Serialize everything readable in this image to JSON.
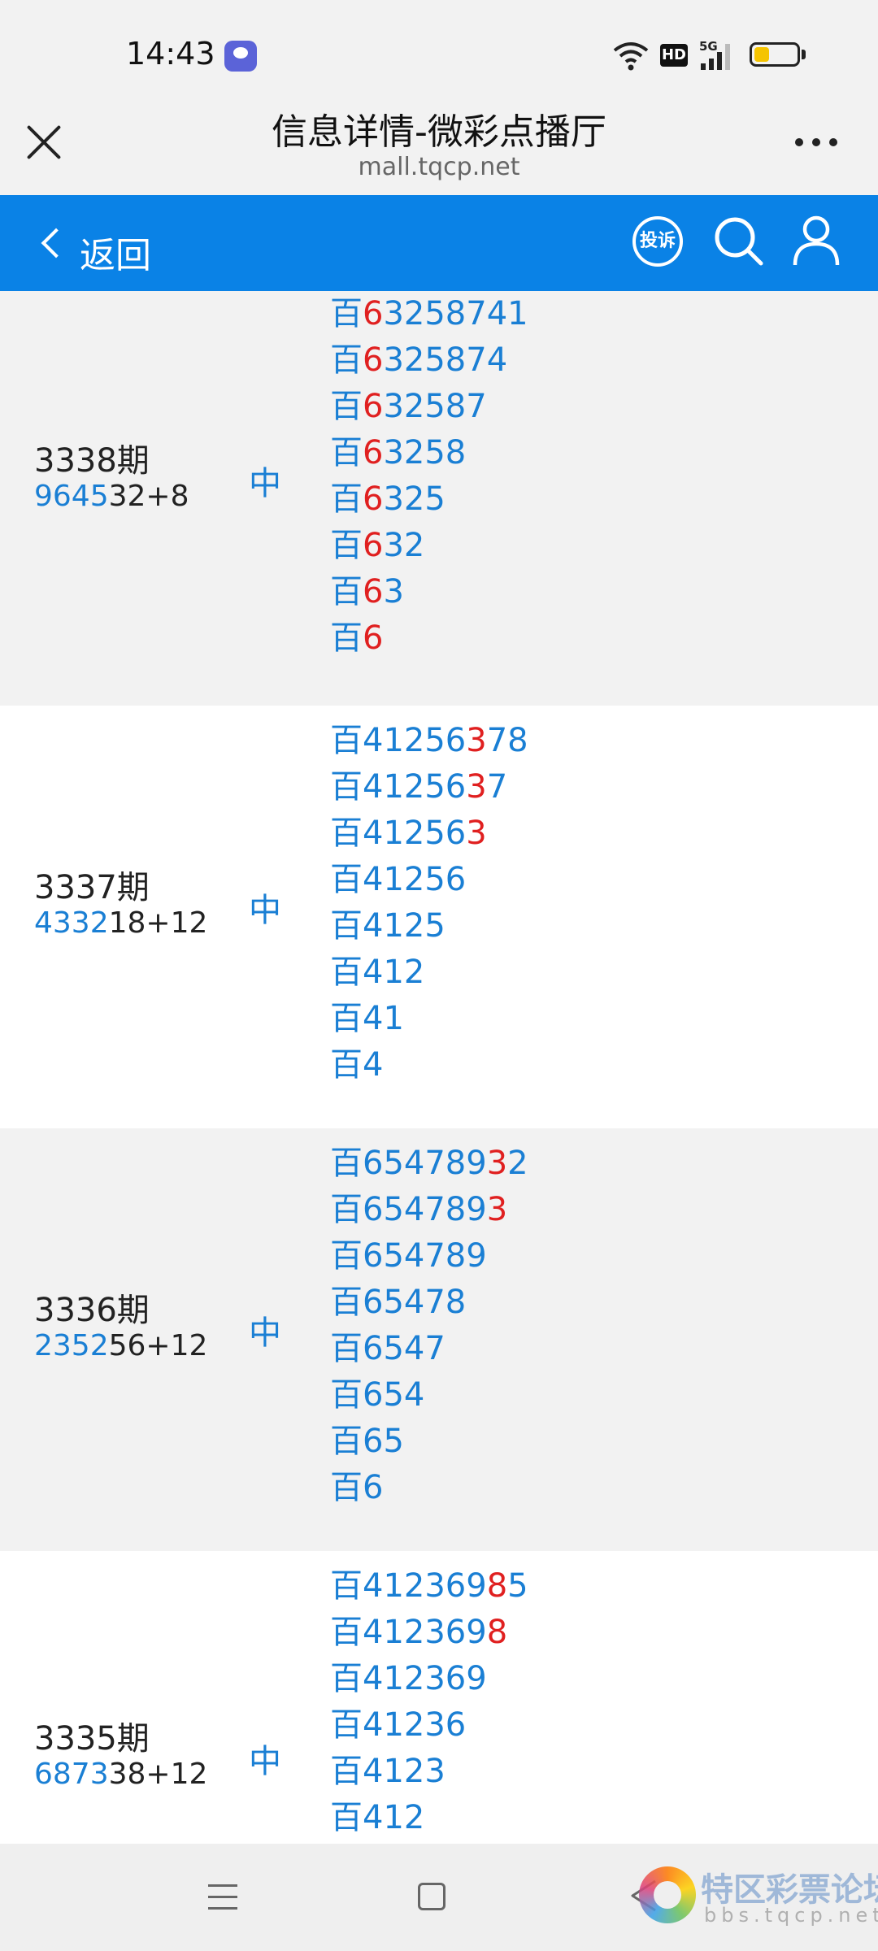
{
  "status_bar": {
    "time": "14:43",
    "hd_label": "HD",
    "network_label": "5G",
    "battery_level": 0.35
  },
  "browser": {
    "title": "信息详情-微彩点播厅",
    "url": "mall.tqcp.net"
  },
  "toolbar": {
    "back_label": "返回",
    "complain_label": "投诉"
  },
  "rows": [
    {
      "period": "3338期",
      "draw_hl": "9645",
      "draw_rest": "32+8",
      "status": "中",
      "picks": [
        {
          "prefix": "百",
          "pre": "",
          "red": "6",
          "post": "3258741"
        },
        {
          "prefix": "百",
          "pre": "",
          "red": "6",
          "post": "325874"
        },
        {
          "prefix": "百",
          "pre": "",
          "red": "6",
          "post": "32587"
        },
        {
          "prefix": "百",
          "pre": "",
          "red": "6",
          "post": "3258"
        },
        {
          "prefix": "百",
          "pre": "",
          "red": "6",
          "post": "325"
        },
        {
          "prefix": "百",
          "pre": "",
          "red": "6",
          "post": "32"
        },
        {
          "prefix": "百",
          "pre": "",
          "red": "6",
          "post": "3"
        },
        {
          "prefix": "百",
          "pre": "",
          "red": "6",
          "post": ""
        }
      ]
    },
    {
      "period": "3337期",
      "draw_hl": "4332",
      "draw_rest": "18+12",
      "status": "中",
      "picks": [
        {
          "prefix": "百",
          "pre": "41256",
          "red": "3",
          "post": "78"
        },
        {
          "prefix": "百",
          "pre": "41256",
          "red": "3",
          "post": "7"
        },
        {
          "prefix": "百",
          "pre": "41256",
          "red": "3",
          "post": ""
        },
        {
          "prefix": "百",
          "pre": "41256",
          "red": "",
          "post": ""
        },
        {
          "prefix": "百",
          "pre": "4125",
          "red": "",
          "post": ""
        },
        {
          "prefix": "百",
          "pre": "412",
          "red": "",
          "post": ""
        },
        {
          "prefix": "百",
          "pre": "41",
          "red": "",
          "post": ""
        },
        {
          "prefix": "百",
          "pre": "4",
          "red": "",
          "post": ""
        }
      ]
    },
    {
      "period": "3336期",
      "draw_hl": "2352",
      "draw_rest": "56+12",
      "status": "中",
      "picks": [
        {
          "prefix": "百",
          "pre": "654789",
          "red": "3",
          "post": "2"
        },
        {
          "prefix": "百",
          "pre": "654789",
          "red": "3",
          "post": ""
        },
        {
          "prefix": "百",
          "pre": "654789",
          "red": "",
          "post": ""
        },
        {
          "prefix": "百",
          "pre": "65478",
          "red": "",
          "post": ""
        },
        {
          "prefix": "百",
          "pre": "6547",
          "red": "",
          "post": ""
        },
        {
          "prefix": "百",
          "pre": "654",
          "red": "",
          "post": ""
        },
        {
          "prefix": "百",
          "pre": "65",
          "red": "",
          "post": ""
        },
        {
          "prefix": "百",
          "pre": "6",
          "red": "",
          "post": ""
        }
      ]
    },
    {
      "period": "3335期",
      "draw_hl": "6873",
      "draw_rest": "38+12",
      "status": "中",
      "picks": [
        {
          "prefix": "百",
          "pre": "412369",
          "red": "8",
          "post": "5"
        },
        {
          "prefix": "百",
          "pre": "412369",
          "red": "8",
          "post": ""
        },
        {
          "prefix": "百",
          "pre": "412369",
          "red": "",
          "post": ""
        },
        {
          "prefix": "百",
          "pre": "41236",
          "red": "",
          "post": ""
        },
        {
          "prefix": "百",
          "pre": "4123",
          "red": "",
          "post": ""
        },
        {
          "prefix": "百",
          "pre": "412",
          "red": "",
          "post": ""
        }
      ]
    }
  ],
  "watermark": {
    "title": "特区彩票论坛",
    "subtitle": "bbs.tqcp.net"
  }
}
